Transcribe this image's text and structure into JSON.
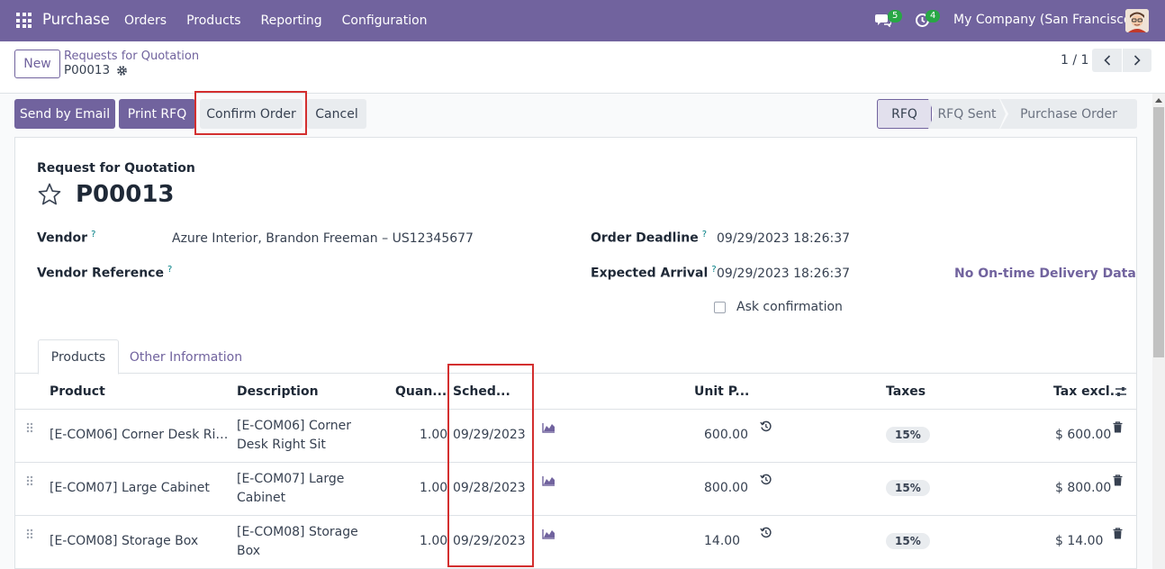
{
  "navbar": {
    "app_name": "Purchase",
    "menu": [
      "Orders",
      "Products",
      "Reporting",
      "Configuration"
    ],
    "chat_badge": "5",
    "activity_badge": "4",
    "company": "My Company (San Francisco)"
  },
  "control_panel": {
    "new_label": "New",
    "breadcrumb": "Requests for Quotation",
    "record_name": "P00013",
    "pager": "1 / 1"
  },
  "actions": {
    "send_email": "Send by Email",
    "print_rfq": "Print RFQ",
    "confirm_order": "Confirm Order",
    "cancel": "Cancel"
  },
  "stages": {
    "rfq": "RFQ",
    "rfq_sent": "RFQ Sent",
    "purchase_order": "Purchase Order"
  },
  "form": {
    "doc_type": "Request for Quotation",
    "doc_number": "P00013",
    "vendor_label": "Vendor",
    "vendor_value": "Azure Interior, Brandon Freeman – US12345677",
    "vendor_ref_label": "Vendor Reference",
    "deadline_label": "Order Deadline",
    "deadline_value": "09/29/2023 18:26:37",
    "arrival_label": "Expected Arrival",
    "arrival_value": "09/29/2023 18:26:37",
    "ontime": "No On-time Delivery Data",
    "ask_confirmation": "Ask confirmation",
    "help_mark": "?"
  },
  "tabs": {
    "products": "Products",
    "other": "Other Information"
  },
  "table": {
    "headers": {
      "product": "Product",
      "description": "Description",
      "quantity": "Quan...",
      "scheduled": "Sched...",
      "unit_price": "Unit P...",
      "taxes": "Taxes",
      "total": "Tax excl."
    },
    "rows": [
      {
        "product": "[E-COM06] Corner Desk Righ...",
        "description": "[E-COM06] Corner Desk Right Sit",
        "quantity": "1.00",
        "date": "09/29/2023",
        "price": "600.00",
        "tax": "15%",
        "total": "$ 600.00"
      },
      {
        "product": "[E-COM07] Large Cabinet",
        "description": "[E-COM07] Large Cabinet",
        "quantity": "1.00",
        "date": "09/28/2023",
        "price": "800.00",
        "tax": "15%",
        "total": "$ 800.00"
      },
      {
        "product": "[E-COM08] Storage Box",
        "description": "[E-COM08] Storage Box",
        "quantity": "1.00",
        "date": "09/29/2023",
        "price": "14.00",
        "tax": "15%",
        "total": "$ 14.00"
      }
    ]
  },
  "colors": {
    "brand": "#71639e",
    "highlight": "#d32f2f",
    "badge": "#28a745"
  }
}
